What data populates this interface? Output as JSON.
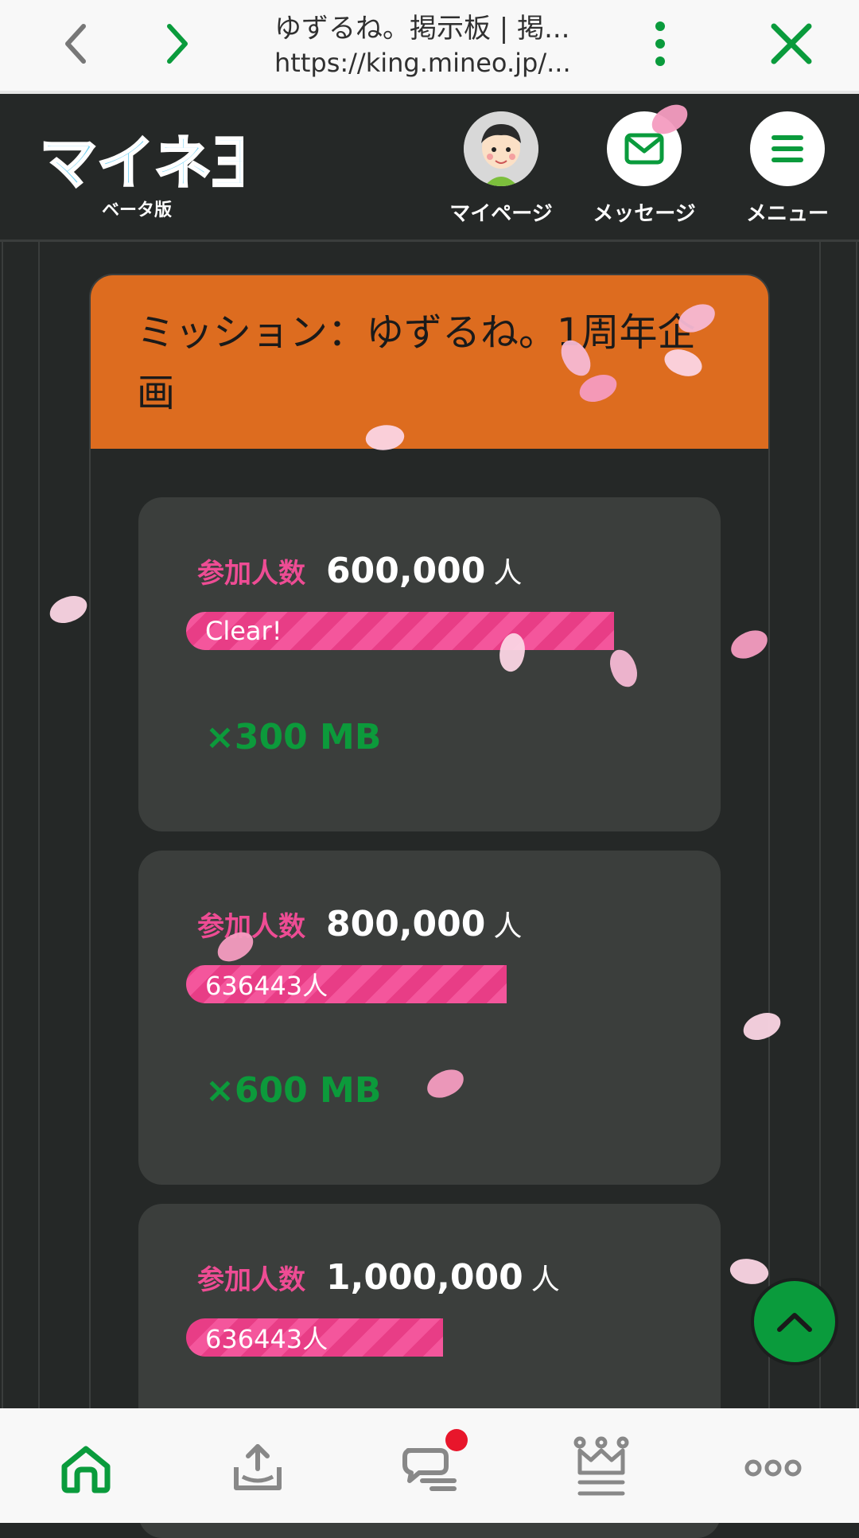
{
  "browser": {
    "title": "ゆずるね。掲示板 | 掲...",
    "url": "https://king.mineo.jp/...",
    "back_icon": "chevron-left-icon",
    "forward_icon": "chevron-right-icon",
    "menu_icon": "kebab-icon",
    "close_icon": "close-icon"
  },
  "header": {
    "logo_text": "マイネ王",
    "logo_sub": "ベータ版",
    "nav": [
      {
        "label": "マイページ",
        "icon": "avatar-icon"
      },
      {
        "label": "メッセージ",
        "icon": "mail-icon"
      },
      {
        "label": "メニュー",
        "icon": "hamburger-icon"
      }
    ]
  },
  "mission": {
    "title": "ミッション：ゆずるね。1周年企画",
    "goals": [
      {
        "label": "参加人数",
        "target": "600,000",
        "unit": "人",
        "progress_text": "Clear!",
        "progress": 1.0,
        "reward": "×300 MB"
      },
      {
        "label": "参加人数",
        "target": "800,000",
        "unit": "人",
        "progress_text": "636443人",
        "progress": 0.7956,
        "reward": "×600 MB"
      },
      {
        "label": "参加人数",
        "target": "1,000,000",
        "unit": "人",
        "progress_text": "636443人",
        "progress": 0.6364,
        "reward": ""
      }
    ]
  },
  "bottom_nav": [
    {
      "icon": "home-icon"
    },
    {
      "icon": "upload-tray-icon"
    },
    {
      "icon": "chat-icon",
      "badge": true
    },
    {
      "icon": "crown-icon"
    },
    {
      "icon": "more-icon"
    }
  ],
  "colors": {
    "accent_green": "#0a9b3c",
    "mission_orange": "#dd6c1f",
    "label_pink": "#ee4c94",
    "bg_dark": "#252827"
  }
}
